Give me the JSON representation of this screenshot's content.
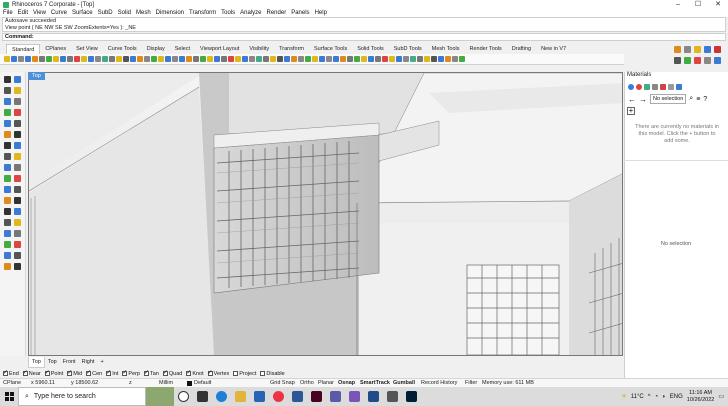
{
  "window": {
    "title": "Rhinoceros 7 Corporate - [Top]",
    "minimize": "–",
    "maximize": "☐",
    "close": "✕"
  },
  "menu": [
    "File",
    "Edit",
    "View",
    "Curve",
    "Surface",
    "SubD",
    "Solid",
    "Mesh",
    "Dimension",
    "Transform",
    "Tools",
    "Analyze",
    "Render",
    "Panels",
    "Help"
  ],
  "command": {
    "history": [
      "Autosave succeeded",
      "View point ( NE  NW  SE  SW  ZoomExtents=Yes ): _NE"
    ],
    "prompt": "Command:"
  },
  "toolbar_tabs": [
    "Standard",
    "CPlanes",
    "Set View",
    "Curve Tools",
    "Display",
    "Select",
    "Viewport Layout",
    "Visibility",
    "Transform",
    "Surface Tools",
    "Solid Tools",
    "SubD Tools",
    "Mesh Tools",
    "Render Tools",
    "Drafting",
    "New in V7"
  ],
  "toolbar_tabs_active": "Standard",
  "viewport": {
    "label": "Top"
  },
  "view_tabs": [
    "Top",
    "Top",
    "Front",
    "Right",
    "+"
  ],
  "view_tabs_active": "Top",
  "osnaps": [
    {
      "label": "End",
      "checked": true
    },
    {
      "label": "Near",
      "checked": true
    },
    {
      "label": "Point",
      "checked": true
    },
    {
      "label": "Mid",
      "checked": true
    },
    {
      "label": "Cen",
      "checked": true
    },
    {
      "label": "Int",
      "checked": true
    },
    {
      "label": "Perp",
      "checked": true
    },
    {
      "label": "Tan",
      "checked": true
    },
    {
      "label": "Quad",
      "checked": true
    },
    {
      "label": "Knot",
      "checked": true
    },
    {
      "label": "Vertex",
      "checked": true
    },
    {
      "label": "Project",
      "checked": false
    },
    {
      "label": "Disable",
      "checked": false
    }
  ],
  "status": {
    "cplane": "CPlane",
    "x": "x 5960.11",
    "y": "y 18500.62",
    "z": "z",
    "units": "Millim",
    "layer": "Default",
    "grid_snap": "Grid Snap",
    "ortho": "Ortho",
    "planar": "Planar",
    "osnap": "Osnap",
    "smarttrack": "SmartTrack",
    "gumball": "Gumball",
    "record_history": "Record History",
    "filter": "Filter",
    "memory": "Memory use: 611 MB"
  },
  "panel": {
    "title": "Materials",
    "selection": "No selection",
    "empty_message": "There are currently no materials in this model. Click the + button to add some.",
    "no_selection": "No selection",
    "add": "+"
  },
  "taskbar": {
    "search_placeholder": "Type here to search",
    "weather": "11°C",
    "lang": "ENG",
    "time": "11:16 AM",
    "date": "10/26/2022"
  },
  "colors": {
    "accent": "#4d8fd8",
    "viewport_bg": "#9a9a9a",
    "building": "#f2f2f2"
  }
}
